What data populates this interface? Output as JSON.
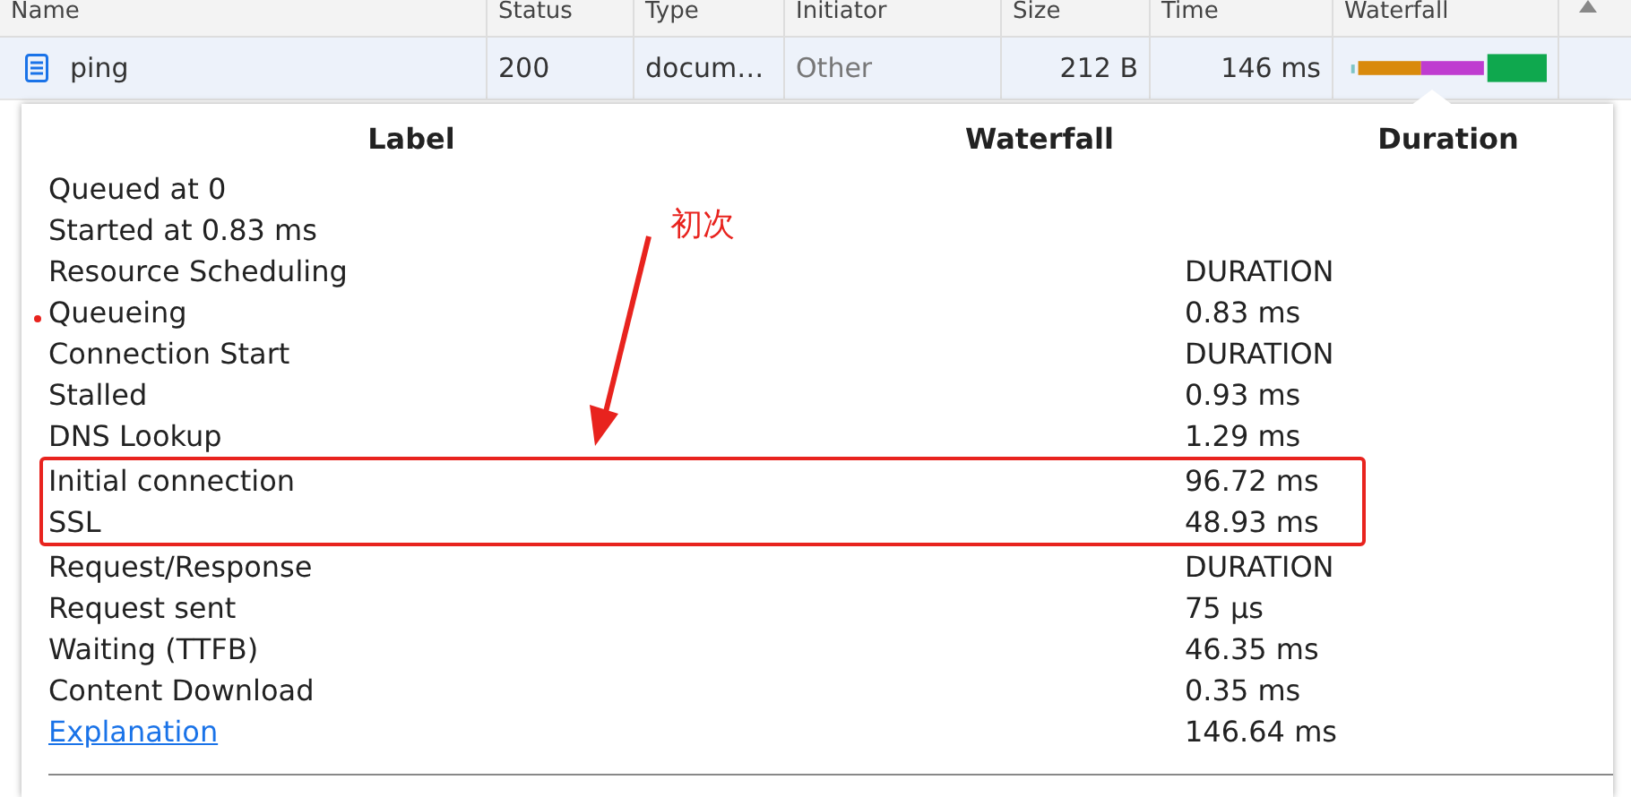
{
  "grid": {
    "columns": [
      "Name",
      "Status",
      "Type",
      "Initiator",
      "Size",
      "Time",
      "Waterfall"
    ],
    "row": {
      "name": "ping",
      "status": "200",
      "type": "docum…",
      "initiator": "Other",
      "size": "212 B",
      "time": "146 ms",
      "selected": true
    }
  },
  "popover": {
    "columns": [
      "Label",
      "Waterfall",
      "Duration"
    ],
    "rows": [
      {
        "kind": "text",
        "label": "Queued at 0",
        "duration": "",
        "boxed": false
      },
      {
        "kind": "text",
        "label": "Started at 0.83 ms",
        "duration": "",
        "boxed": false
      },
      {
        "kind": "text",
        "label": "Resource Scheduling",
        "duration": "DURATION",
        "boxed": false
      },
      {
        "kind": "text",
        "label": "Queueing",
        "duration": "0.83 ms",
        "boxed": false
      },
      {
        "kind": "text",
        "label": "Connection Start",
        "duration": "DURATION",
        "boxed": false
      },
      {
        "kind": "text",
        "label": "Stalled",
        "duration": "0.93 ms",
        "boxed": false
      },
      {
        "kind": "text",
        "label": "DNS Lookup",
        "duration": "1.29 ms",
        "boxed": false
      },
      {
        "kind": "text",
        "label": "Initial connection",
        "duration": "96.72 ms",
        "boxed": true
      },
      {
        "kind": "text",
        "label": "SSL",
        "duration": "48.93 ms",
        "boxed": true
      },
      {
        "kind": "text",
        "label": "Request/Response",
        "duration": "DURATION",
        "boxed": false
      },
      {
        "kind": "text",
        "label": "Request sent",
        "duration": "75 µs",
        "boxed": false
      },
      {
        "kind": "text",
        "label": "Waiting (TTFB)",
        "duration": "46.35 ms",
        "boxed": false
      },
      {
        "kind": "text",
        "label": "Content Download",
        "duration": "0.35 ms",
        "boxed": false
      },
      {
        "kind": "link",
        "label": "Explanation",
        "duration": "146.64 ms",
        "boxed": false
      }
    ]
  },
  "annotation": {
    "label": "初次"
  }
}
